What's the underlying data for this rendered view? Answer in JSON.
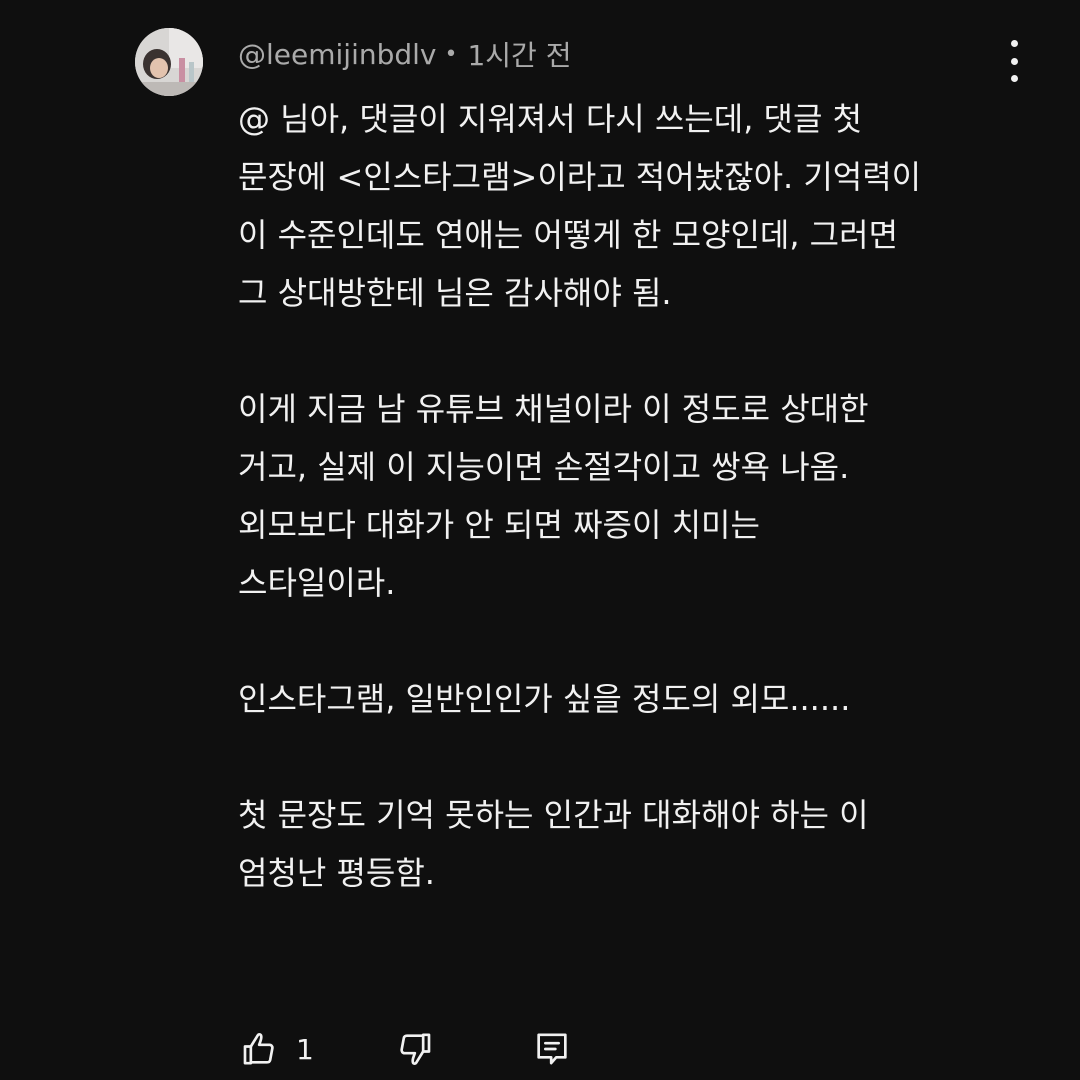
{
  "comment": {
    "author": "@leemijinbdlv",
    "separator": "•",
    "time": "1시간 전",
    "lines": [
      "@ 님아, 댓글이 지워져서 다시 쓰는데, 댓글 첫",
      "문장에 <인스타그램>이라고 적어놨잖아. 기억력이",
      "이 수준인데도 연애는 어떻게 한 모양인데, 그러면",
      "그 상대방한테 님은 감사해야 됨.",
      "",
      "이게 지금 남 유튜브 채널이라 이 정도로 상대한",
      "거고, 실제 이 지능이면 손절각이고 쌍욕 나옴.",
      "외모보다 대화가 안 되면 짜증이 치미는",
      "스타일이라.",
      "",
      "인스타그램, 일반인인가 싶을 정도의 외모......",
      "",
      "첫 문장도 기억 못하는 인간과 대화해야 하는 이",
      "엄청난 평등함."
    ],
    "like_count": "1"
  },
  "icons": {
    "more": "more-vertical-icon",
    "like": "thumbs-up-icon",
    "dislike": "thumbs-down-icon",
    "reply": "reply-comment-icon"
  },
  "colors": {
    "background": "#0f0f0f",
    "text": "#f1f1f1",
    "meta": "#aaaaaa"
  }
}
